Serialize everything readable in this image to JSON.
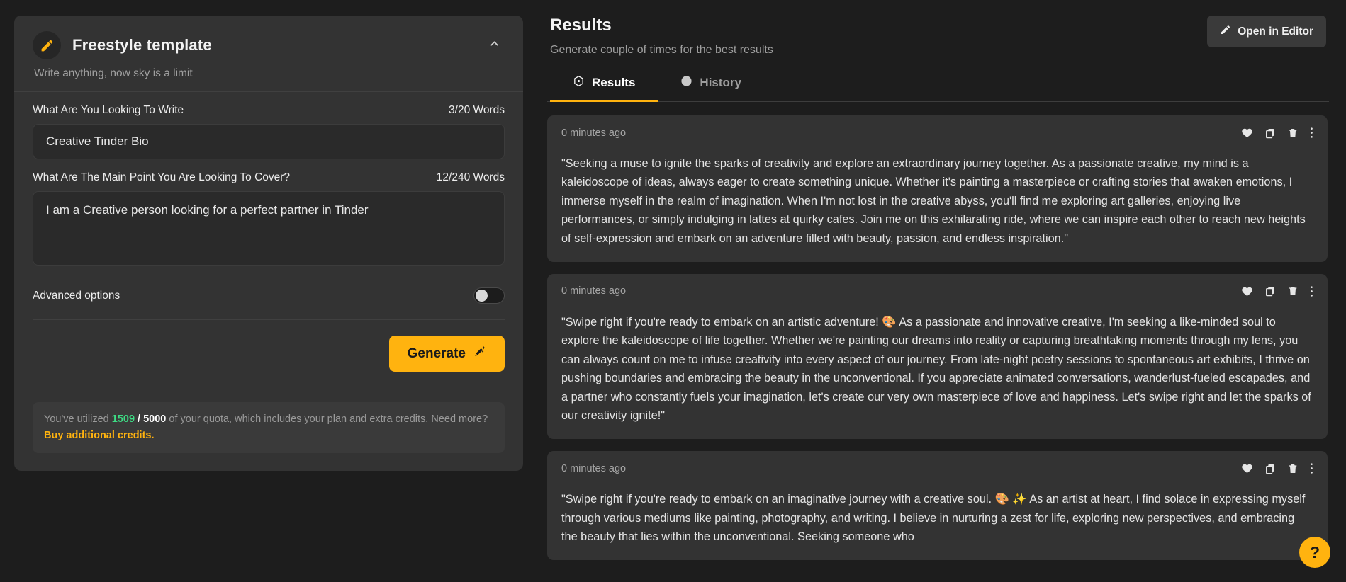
{
  "left_panel": {
    "icon": "pencil-icon",
    "title": "Freestyle template",
    "subtitle": "Write anything, now sky is a limit",
    "collapse_icon": "chevron-up-icon",
    "field1": {
      "label": "What Are You Looking To Write",
      "counter": "3/20 Words",
      "value": "Creative Tinder Bio",
      "placeholder": "Creative Tinder Bio"
    },
    "field2": {
      "label": "What Are The Main Point You Are Looking To Cover?",
      "counter": "12/240 Words",
      "value": "I am a Creative person looking for a perfect partner in Tinder",
      "placeholder": "I am a Creative person looking for a perfect partner in Tinder"
    },
    "advanced_options_label": "Advanced options",
    "advanced_options_on": false,
    "generate_label": "Generate",
    "generate_icon": "magic-wand-icon",
    "quota": {
      "prefix": "You've utilized ",
      "used": "1509",
      "separator": " / ",
      "total": "5000",
      "middle": " of your quota, which includes your plan and extra credits. Need more? ",
      "link": "Buy additional credits."
    }
  },
  "right_panel": {
    "title": "Results",
    "subtitle": "Generate couple of times for the best results",
    "open_in_editor": "Open in Editor",
    "open_in_editor_icon": "pencil-icon",
    "tabs": [
      {
        "label": "Results",
        "icon": "atom-icon",
        "active": true
      },
      {
        "label": "History",
        "icon": "clock-icon",
        "active": false
      }
    ],
    "card_actions": [
      {
        "name": "favorite-icon",
        "label": "Favorite"
      },
      {
        "name": "copy-icon",
        "label": "Copy"
      },
      {
        "name": "delete-icon",
        "label": "Delete"
      },
      {
        "name": "more-options-icon",
        "label": "More"
      }
    ],
    "results": [
      {
        "time": "0 minutes ago",
        "text": "\"Seeking a muse to ignite the sparks of creativity and explore an extraordinary journey together. As a passionate creative, my mind is a kaleidoscope of ideas, always eager to create something unique. Whether it's painting a masterpiece or crafting stories that awaken emotions, I immerse myself in the realm of imagination. When I'm not lost in the creative abyss, you'll find me exploring art galleries, enjoying live performances, or simply indulging in lattes at quirky cafes. Join me on this exhilarating ride, where we can inspire each other to reach new heights of self-expression and embark on an adventure filled with beauty, passion, and endless inspiration.\""
      },
      {
        "time": "0 minutes ago",
        "text": "\"Swipe right if you're ready to embark on an artistic adventure! 🎨 As a passionate and innovative creative, I'm seeking a like-minded soul to explore the kaleidoscope of life together. Whether we're painting our dreams into reality or capturing breathtaking moments through my lens, you can always count on me to infuse creativity into every aspect of our journey. From late-night poetry sessions to spontaneous art exhibits, I thrive on pushing boundaries and embracing the beauty in the unconventional. If you appreciate animated conversations, wanderlust-fueled escapades, and a partner who constantly fuels your imagination, let's create our very own masterpiece of love and happiness. Let's swipe right and let the sparks of our creativity ignite!\""
      },
      {
        "time": "0 minutes ago",
        "text": "\"Swipe right if you're ready to embark on an imaginative journey with a creative soul. 🎨 ✨ As an artist at heart, I find solace in expressing myself through various mediums like painting, photography, and writing. I believe in nurturing a zest for life, exploring new perspectives, and embracing the beauty that lies within the unconventional. Seeking someone who"
      }
    ],
    "help_label": "?"
  }
}
